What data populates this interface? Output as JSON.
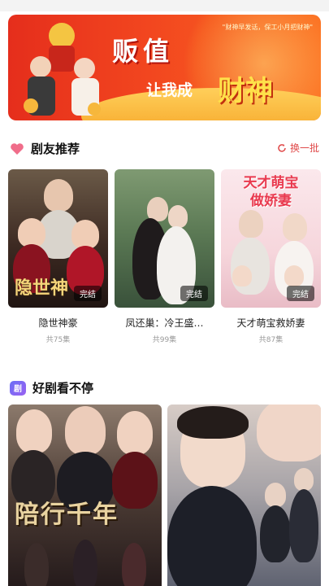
{
  "banner": {
    "brand": "贩值",
    "slogan_prefix": "让我成",
    "slogan_highlight": "财神",
    "note": "\"财神早发话，保工小月把财神\""
  },
  "recommend": {
    "title": "剧友推荐",
    "refresh_label": "换一批",
    "items": [
      {
        "title": "隐世神豪",
        "episodes": "共75集",
        "badge": "完结",
        "poster_text": "隐世神"
      },
      {
        "title": "凤还巢：冷王盛…",
        "episodes": "共99集",
        "badge": "完结",
        "poster_text": ""
      },
      {
        "title": "天才萌宝救娇妻",
        "episodes": "共87集",
        "badge": "完结",
        "poster_text": "天才萌宝\n做娇妻"
      }
    ]
  },
  "nonstop": {
    "title": "好剧看不停",
    "icon_label": "剧",
    "items": [
      {
        "poster_text": "陪行千年"
      },
      {
        "poster_text": ""
      }
    ]
  },
  "colors": {
    "accent": "#e04a4a",
    "banner_red": "#e52e1c",
    "banner_gold": "#ffe14a"
  }
}
